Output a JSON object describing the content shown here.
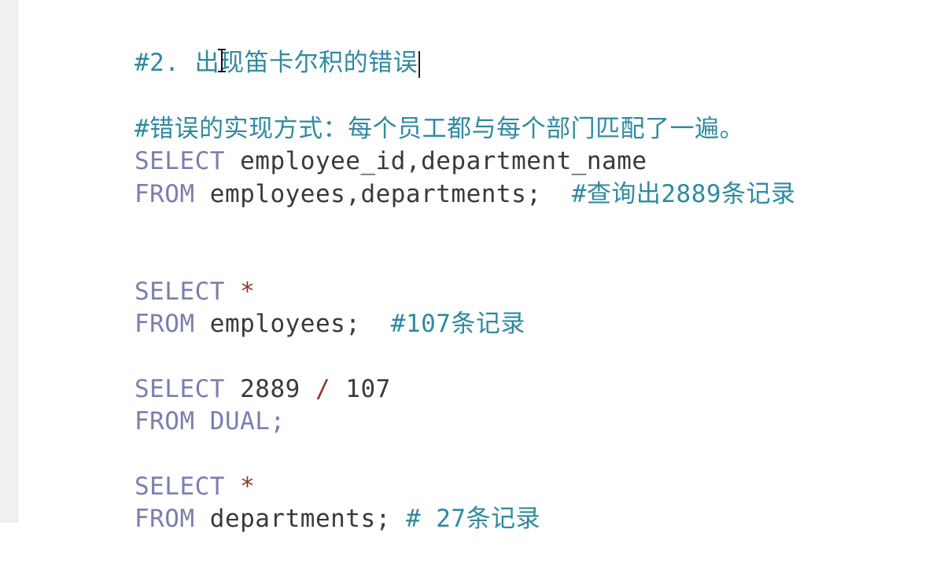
{
  "editor": {
    "lines": {
      "heading_comment": "#2. 出现笛卡尔积的错误",
      "desc_comment": "#错误的实现方式：每个员工都与每个部门匹配了一遍。",
      "q1_select_kw": "SELECT",
      "q1_select_cols": " employee_id,department_name",
      "q1_from_kw": "FROM",
      "q1_from_tables": " employees,departments;",
      "q1_comment": "  #查询出2889条记录",
      "q2_select_kw": "SELECT",
      "q2_star": " *",
      "q2_from_kw": "FROM",
      "q2_from_table": " employees;",
      "q2_comment": "  #107条记录",
      "q3_select_kw": "SELECT",
      "q3_num1": " 2889",
      "q3_div": " /",
      "q3_num2": " 107",
      "q3_from_kw": "FROM",
      "q3_dual": " DUAL;",
      "q4_select_kw": "SELECT",
      "q4_star": " *",
      "q4_from_kw": "FROM",
      "q4_from_table": " departments;",
      "q4_comment": " # 27条记录"
    }
  }
}
